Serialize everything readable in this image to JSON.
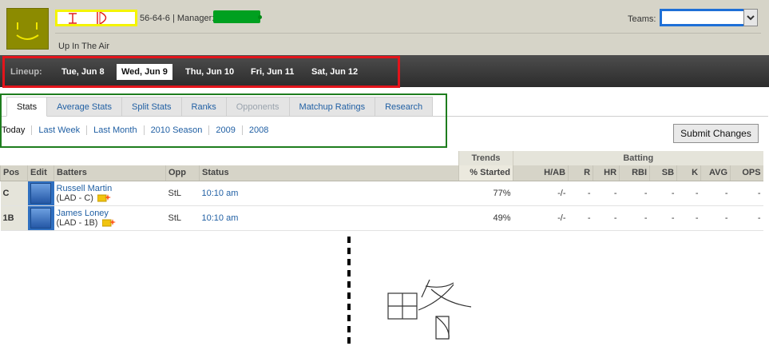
{
  "header": {
    "team_name": "",
    "record": "56-64-6 | Manager:",
    "motto": "Up In The Air",
    "teams_label": "Teams:",
    "teams_selected": ""
  },
  "lineup": {
    "label": "Lineup:",
    "days": [
      "Tue, Jun 8",
      "Wed, Jun 9",
      "Thu, Jun 10",
      "Fri, Jun 11",
      "Sat, Jun 12"
    ],
    "selected_day": "Wed, Jun 9"
  },
  "tabs": {
    "items": [
      "Stats",
      "Average Stats",
      "Split Stats",
      "Ranks",
      "Opponents",
      "Matchup Ratings",
      "Research"
    ],
    "active": "Stats",
    "disabled": [
      "Opponents"
    ]
  },
  "periods": [
    "Today",
    "Last Week",
    "Last Month",
    "2010 Season",
    "2009",
    "2008"
  ],
  "submit_label": "Submit Changes",
  "table": {
    "groups": {
      "trends": "Trends",
      "batting": "Batting"
    },
    "columns": [
      "Pos",
      "Edit",
      "Batters",
      "Opp",
      "Status",
      "% Started",
      "H/AB",
      "R",
      "HR",
      "RBI",
      "SB",
      "K",
      "AVG",
      "OPS"
    ],
    "rows": [
      {
        "pos": "C",
        "player": "Russell Martin",
        "info": "(LAD - C)",
        "opp": "StL",
        "status": "10:10 am",
        "pct_started": "77%",
        "hab": "-/-",
        "r": "-",
        "hr": "-",
        "rbi": "-",
        "sb": "-",
        "k": "-",
        "avg": "-",
        "ops": "-"
      },
      {
        "pos": "1B",
        "player": "James Loney",
        "info": "(LAD - 1B)",
        "opp": "StL",
        "status": "10:10 am",
        "pct_started": "49%",
        "hab": "-/-",
        "r": "-",
        "hr": "-",
        "rbi": "-",
        "sb": "-",
        "k": "-",
        "avg": "-",
        "ops": "-"
      }
    ]
  },
  "drawing": {
    "handwritten_text": "略"
  },
  "colors": {
    "lineup_highlight": "#e3141b",
    "tabs_highlight": "#1e7d1e",
    "team_name_highlight": "#f4f400",
    "manager_mark": "#00a020",
    "teams_select_border": "#1e6fd6",
    "link": "#2160a4"
  },
  "icons": [
    "smiley-avatar-icon",
    "dropdown-arrow-icon",
    "edit-icon",
    "note-icon"
  ]
}
